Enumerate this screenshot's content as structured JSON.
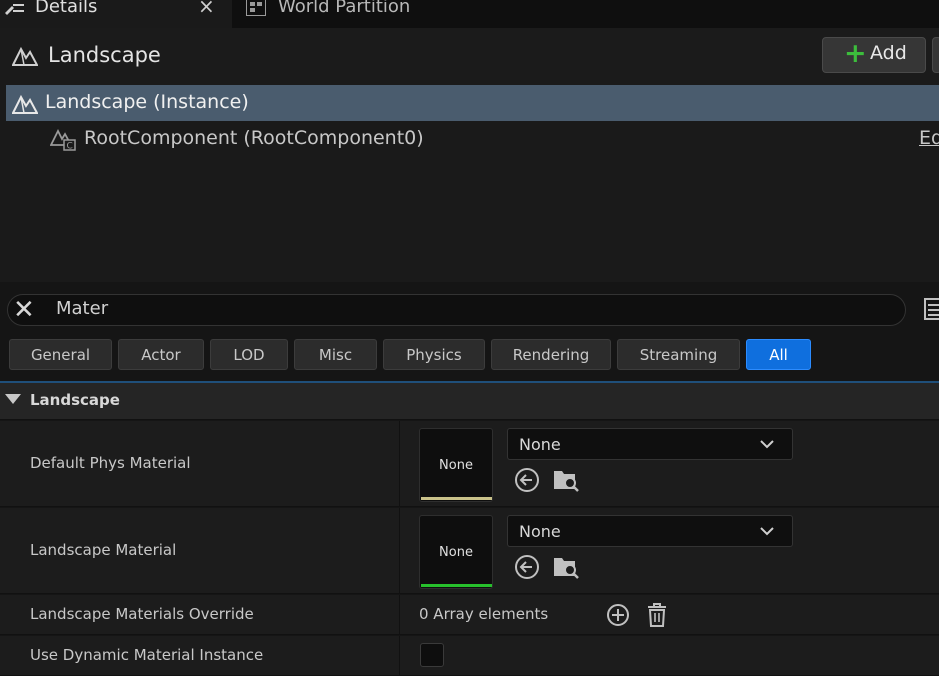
{
  "tabs": [
    {
      "label": "Details",
      "icon": "details-icon"
    },
    {
      "label": "World Partition",
      "icon": "world-partition-icon"
    }
  ],
  "header": {
    "title": "Landscape",
    "add_label": "Add"
  },
  "tree": {
    "instance_label": "Landscape (Instance)",
    "root_label": "RootComponent (RootComponent0)",
    "edit_link": "Ed"
  },
  "search": {
    "value": "Mater"
  },
  "filters": [
    "General",
    "Actor",
    "LOD",
    "Misc",
    "Physics",
    "Rendering",
    "Streaming",
    "All"
  ],
  "active_filter": "All",
  "category": {
    "label": "Landscape"
  },
  "properties": {
    "default_phys_material": {
      "label": "Default Phys Material",
      "thumb": "None",
      "value": "None",
      "accent": "#c9c28a"
    },
    "landscape_material": {
      "label": "Landscape Material",
      "thumb": "None",
      "value": "None",
      "accent": "#27c02c"
    },
    "materials_override": {
      "label": "Landscape Materials Override",
      "value": "0 Array elements"
    },
    "use_dynamic": {
      "label": "Use Dynamic Material Instance",
      "checked": false
    }
  },
  "colors": {
    "accent_blue": "#0f6fde",
    "add_green": "#3cbd3c",
    "selection": "#4a5c6e"
  }
}
